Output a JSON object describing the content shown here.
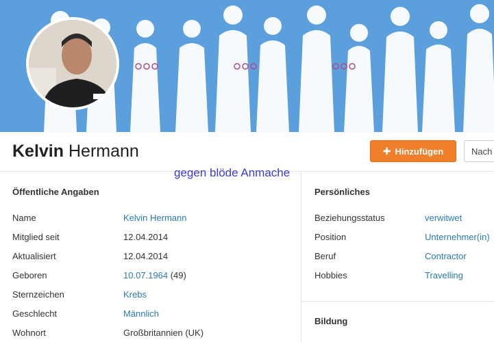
{
  "profile": {
    "first_name": "Kelvin",
    "last_name": "Hermann",
    "add_button_label": "Hinzufügen",
    "next_button_label": "Nach"
  },
  "overlay_text": "gegen blöde Anmache",
  "public_info": {
    "title": "Öffentliche Angaben",
    "rows": [
      {
        "label": "Name",
        "value": "Kelvin Hermann",
        "extra": ""
      },
      {
        "label": "Mitglied seit",
        "value": "12.04.2014",
        "extra": ""
      },
      {
        "label": "Aktualisiert",
        "value": "12.04.2014",
        "extra": ""
      },
      {
        "label": "Geboren",
        "value": "10.07.1964",
        "extra": "(49)"
      },
      {
        "label": "Sternzeichen",
        "value": "Krebs",
        "extra": ""
      },
      {
        "label": "Geschlecht",
        "value": "Männlich",
        "extra": ""
      },
      {
        "label": "Wohnort",
        "value": "Großbritannien (UK)",
        "extra": ""
      }
    ]
  },
  "personal": {
    "title": "Persönliches",
    "rows": [
      {
        "label": "Beziehungsstatus",
        "value": "verwitwet"
      },
      {
        "label": "Position",
        "value": "Unternehmer(in)"
      },
      {
        "label": "Beruf",
        "value": "Contractor"
      },
      {
        "label": "Hobbies",
        "value": "Travelling"
      }
    ]
  },
  "education": {
    "title": "Bildung"
  },
  "colors": {
    "banner": "#5b9fdd",
    "accent": "#f07f2c",
    "link": "#2a7ab0",
    "overlay": "#3a3adb"
  },
  "icons": {
    "add": "plus-icon"
  }
}
